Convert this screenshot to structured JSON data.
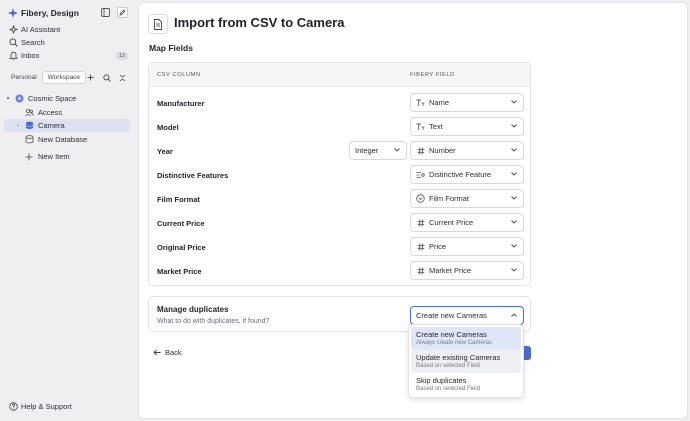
{
  "sidebar": {
    "workspace_name": "Fibery, Design",
    "nav": [
      {
        "label": "AI Assistant",
        "icon": "sparkle-icon"
      },
      {
        "label": "Search",
        "icon": "search-icon"
      },
      {
        "label": "Inbox",
        "icon": "bell-icon",
        "badge": "12"
      }
    ],
    "tabs": [
      {
        "label": "Personal",
        "active": false
      },
      {
        "label": "Workspace",
        "active": true
      }
    ],
    "tree": [
      {
        "label": "Cosmic Space",
        "icon": "space-icon",
        "chevron": "▾"
      },
      {
        "label": "Access",
        "icon": "users-icon"
      },
      {
        "label": "Camera",
        "icon": "database-icon",
        "chevron": "›",
        "selected": true
      },
      {
        "label": "New Database",
        "icon": "new-database-icon"
      },
      {
        "label": "New Item",
        "icon": "plus-icon"
      }
    ],
    "help_label": "Help & Support"
  },
  "main": {
    "title": "Import from CSV to Camera",
    "map_fields_heading": "Map Fields",
    "col_csv": "CSV COLUMN",
    "col_fibery": "FIBERY FIELD",
    "rows": [
      {
        "csv": "Manufacturer",
        "field": "Name",
        "field_icon": "text-type-icon"
      },
      {
        "csv": "Model",
        "field": "Text",
        "field_icon": "text-type-icon"
      },
      {
        "csv": "Year",
        "type": "Integer",
        "field": "Number",
        "field_icon": "hash-icon"
      },
      {
        "csv": "Distinctive Features",
        "field": "Distinctive Feature",
        "field_icon": "multi-select-icon"
      },
      {
        "csv": "Film Format",
        "field": "Film Format",
        "field_icon": "single-select-icon"
      },
      {
        "csv": "Current Price",
        "field": "Current Price",
        "field_icon": "hash-icon"
      },
      {
        "csv": "Original Price",
        "field": "Price",
        "field_icon": "hash-icon"
      },
      {
        "csv": "Market Price",
        "field": "Market Price",
        "field_icon": "hash-icon"
      }
    ],
    "duplicates": {
      "title": "Manage duplicates",
      "subtitle": "What to do with duplicates, if found?",
      "selected": "Create new Cameras",
      "options": [
        {
          "label": "Create new Cameras",
          "desc": "Always create new Cameras",
          "state": "selected"
        },
        {
          "label": "Update existing Cameras",
          "desc": "Based on selected Field",
          "state": "hover"
        },
        {
          "label": "Skip duplicates",
          "desc": "Based on selected Field",
          "state": "normal"
        }
      ]
    },
    "back_label": "Back"
  },
  "colors": {
    "accent": "#4a6bd0",
    "selected_bg": "#dde1f0",
    "sidebar_bg": "#efeff1"
  }
}
